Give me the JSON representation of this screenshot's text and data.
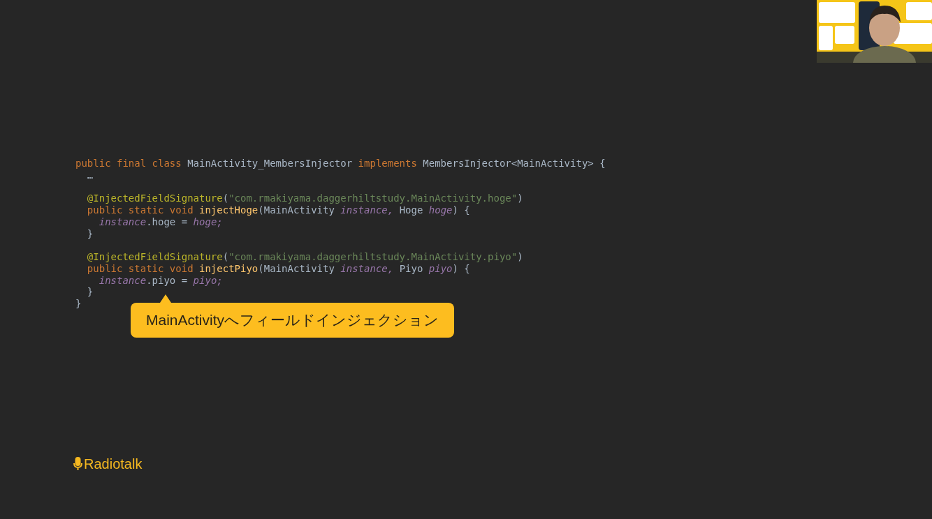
{
  "code": {
    "lines": [
      {
        "kind": "code",
        "tokens": [
          {
            "kind": "keyword",
            "text": "public final class "
          },
          {
            "kind": "plain",
            "text": "MainActivity_MembersInjector "
          },
          {
            "kind": "keyword",
            "text": "implements "
          },
          {
            "kind": "plain",
            "text": "MembersInjector<MainActivity> {"
          }
        ]
      },
      {
        "kind": "code",
        "tokens": [
          {
            "kind": "plain",
            "text": "  …"
          }
        ]
      },
      {
        "kind": "blank"
      },
      {
        "kind": "code",
        "tokens": [
          {
            "kind": "annotation",
            "text": "  @InjectedFieldSignature"
          },
          {
            "kind": "plain",
            "text": "("
          },
          {
            "kind": "string",
            "text": "\"com.rmakiyama.daggerhiltstudy.MainActivity.hoge\""
          },
          {
            "kind": "plain",
            "text": ")"
          }
        ]
      },
      {
        "kind": "code",
        "tokens": [
          {
            "kind": "keyword",
            "text": "  public static void "
          },
          {
            "kind": "method",
            "text": "injectHoge"
          },
          {
            "kind": "plain",
            "text": "(MainActivity "
          },
          {
            "kind": "param",
            "text": "instance, "
          },
          {
            "kind": "plain",
            "text": "Hoge "
          },
          {
            "kind": "param",
            "text": "hoge"
          },
          {
            "kind": "plain",
            "text": ") {"
          }
        ]
      },
      {
        "kind": "code",
        "tokens": [
          {
            "kind": "param",
            "text": "    instance"
          },
          {
            "kind": "plain",
            "text": ".hoge = "
          },
          {
            "kind": "param",
            "text": "hoge;"
          }
        ]
      },
      {
        "kind": "code",
        "tokens": [
          {
            "kind": "plain",
            "text": "  }"
          }
        ]
      },
      {
        "kind": "blank"
      },
      {
        "kind": "code",
        "tokens": [
          {
            "kind": "annotation",
            "text": "  @InjectedFieldSignature"
          },
          {
            "kind": "plain",
            "text": "("
          },
          {
            "kind": "string",
            "text": "\"com.rmakiyama.daggerhiltstudy.MainActivity.piyo\""
          },
          {
            "kind": "plain",
            "text": ")"
          }
        ]
      },
      {
        "kind": "code",
        "tokens": [
          {
            "kind": "keyword",
            "text": "  public static void "
          },
          {
            "kind": "method",
            "text": "injectPiyo"
          },
          {
            "kind": "plain",
            "text": "(MainActivity "
          },
          {
            "kind": "param",
            "text": "instance, "
          },
          {
            "kind": "plain",
            "text": "Piyo "
          },
          {
            "kind": "param",
            "text": "piyo"
          },
          {
            "kind": "plain",
            "text": ") {"
          }
        ]
      },
      {
        "kind": "code",
        "tokens": [
          {
            "kind": "param",
            "text": "    instance"
          },
          {
            "kind": "plain",
            "text": ".piyo = "
          },
          {
            "kind": "param",
            "text": "piyo;"
          }
        ]
      },
      {
        "kind": "code",
        "tokens": [
          {
            "kind": "plain",
            "text": "  }"
          }
        ]
      },
      {
        "kind": "code",
        "tokens": [
          {
            "kind": "plain",
            "text": "}"
          }
        ]
      }
    ]
  },
  "callout": {
    "text": "MainActivityへフィールドインジェクション"
  },
  "logo": {
    "text": "Radiotalk"
  }
}
